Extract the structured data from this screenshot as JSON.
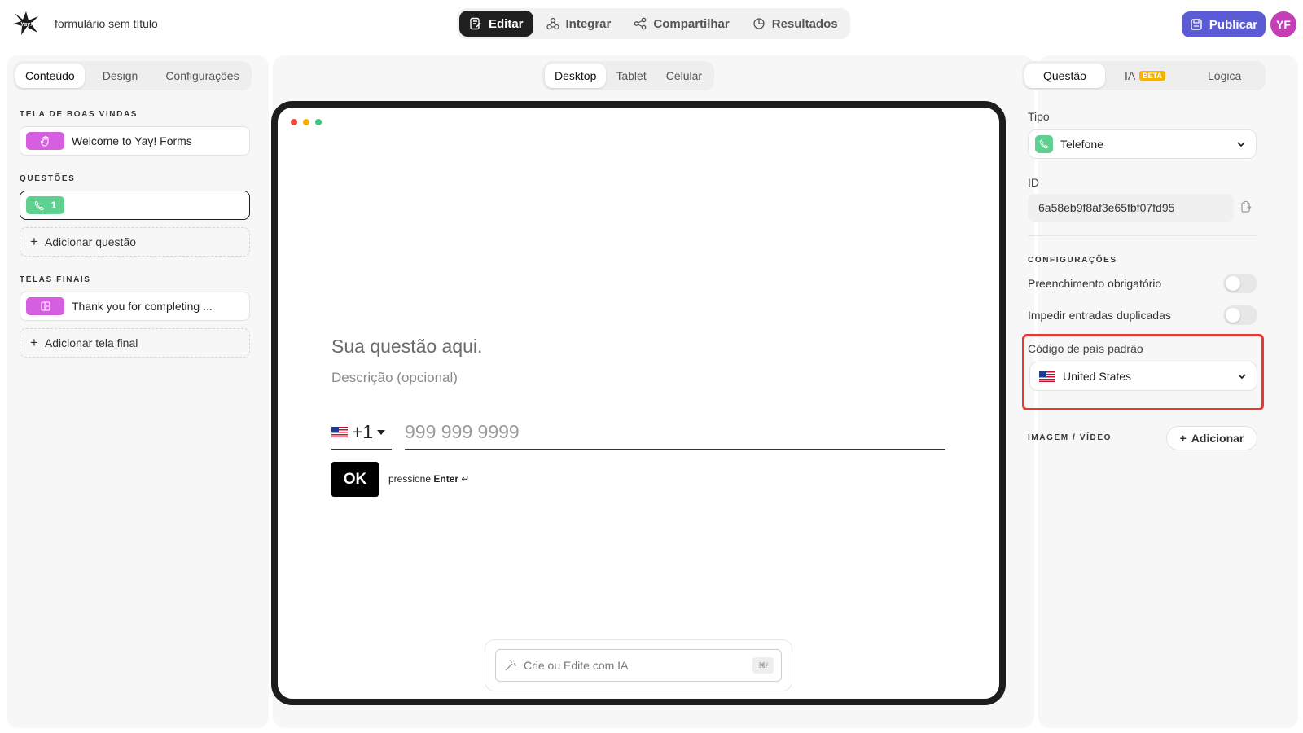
{
  "header": {
    "form_title": "formulário sem título",
    "tabs": [
      {
        "label": "Editar",
        "icon": "edit-icon",
        "active": true
      },
      {
        "label": "Integrar",
        "icon": "integrate-icon",
        "active": false
      },
      {
        "label": "Compartilhar",
        "icon": "share-icon",
        "active": false
      },
      {
        "label": "Resultados",
        "icon": "results-icon",
        "active": false
      }
    ],
    "publish_label": "Publicar",
    "avatar_initials": "YF"
  },
  "left_panel": {
    "tabs": [
      "Conteúdo",
      "Design",
      "Configurações"
    ],
    "active_tab": "Conteúdo",
    "welcome_section": "TELA DE BOAS VINDAS",
    "welcome_item": "Welcome to Yay! Forms",
    "questions_section": "QUESTÕES",
    "question_number": "1",
    "add_question": "Adicionar questão",
    "endings_section": "TELAS FINAIS",
    "ending_item": "Thank you for completing ...",
    "add_ending": "Adicionar tela final"
  },
  "preview": {
    "devices": [
      "Desktop",
      "Tablet",
      "Celular"
    ],
    "active_device": "Desktop",
    "question_title": "Sua questão aqui.",
    "question_desc": "Descrição (opcional)",
    "country_code": "+1",
    "phone_placeholder": "999 999 9999",
    "ok_label": "OK",
    "hint_prefix": "pressione",
    "hint_key": "Enter",
    "hint_symbol": "↵",
    "ai_placeholder": "Crie ou Edite com IA",
    "ai_shortcut": "⌘/"
  },
  "right_panel": {
    "tabs": [
      "Questão",
      "IA",
      "Lógica"
    ],
    "active_tab": "Questão",
    "beta_badge": "BETA",
    "type_label": "Tipo",
    "type_value": "Telefone",
    "id_label": "ID",
    "id_value": "6a58eb9f8af3e65fbf07fd95",
    "settings_section": "CONFIGURAÇÕES",
    "required_label": "Preenchimento obrigatório",
    "required_on": false,
    "dedupe_label": "Impedir entradas duplicadas",
    "dedupe_on": false,
    "country_label": "Código de país padrão",
    "country_value": "United States",
    "media_section": "IMAGEM / VÍDEO",
    "add_label": "Adicionar"
  },
  "colors": {
    "accent": "#5b5bd6",
    "avatar": "#c43fb6",
    "green_chip": "#5fd08f",
    "pink_chip": "#d65ee0",
    "highlight": "#e53935",
    "beta": "#f5b400"
  }
}
